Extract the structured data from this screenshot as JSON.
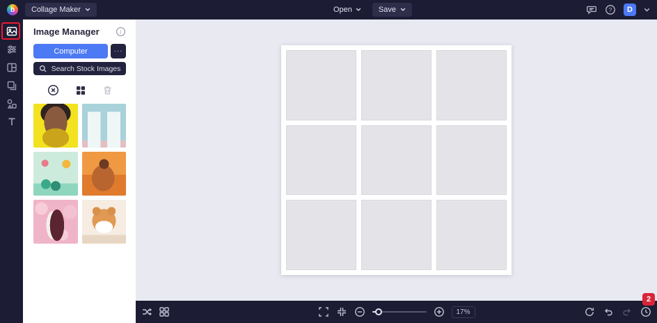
{
  "topbar": {
    "logo_letter": "b",
    "collage_maker_label": "Collage Maker",
    "open_label": "Open",
    "save_label": "Save",
    "avatar_initial": "D"
  },
  "rail": {
    "items": [
      {
        "name": "image-manager",
        "active": true
      },
      {
        "name": "edit-effects",
        "active": false
      },
      {
        "name": "layouts",
        "active": false
      },
      {
        "name": "backgrounds",
        "active": false
      },
      {
        "name": "graphics",
        "active": false
      },
      {
        "name": "text",
        "active": false
      }
    ]
  },
  "sidebar": {
    "title": "Image Manager",
    "computer_button": "Computer",
    "more_button": "···",
    "search_button": "Search Stock Images",
    "thumbnails": [
      {
        "name": "portrait-woman-yellow"
      },
      {
        "name": "pastel-blue-doors"
      },
      {
        "name": "bicycle-illustration-mint"
      },
      {
        "name": "man-sitting-orange"
      },
      {
        "name": "wedding-couple-pink-blossoms"
      },
      {
        "name": "shiba-inu-dog"
      }
    ]
  },
  "canvas": {
    "collage_grid": {
      "rows": 3,
      "cols": 3
    }
  },
  "bottombar": {
    "zoom_label": "17%",
    "history_badge": "2"
  },
  "icons": {
    "topbar": [
      "chevron-down-icon",
      "comment-icon",
      "help-icon",
      "chevron-down-icon"
    ],
    "sidebar": [
      "info-icon",
      "search-icon",
      "deselect-icon",
      "collage-grid-icon",
      "trash-icon"
    ],
    "bottombar": [
      "shuffle-icon",
      "layout-grid-icon",
      "fullscreen-icon",
      "fit-screen-icon",
      "zoom-out-icon",
      "zoom-in-icon",
      "reset-icon",
      "undo-icon",
      "redo-icon",
      "history-icon"
    ]
  },
  "colors": {
    "accent_blue": "#4c79f4",
    "annotation_red": "#ec1c2e",
    "badge_red": "#da2438",
    "dark_bg": "#1c1c34"
  }
}
